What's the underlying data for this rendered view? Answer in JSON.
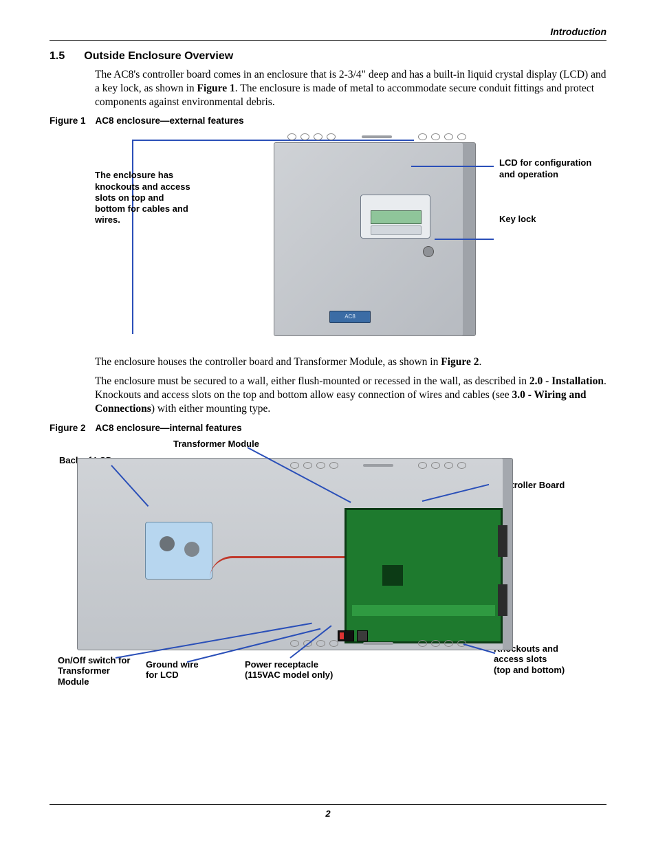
{
  "running_head": "Introduction",
  "section": {
    "num": "1.5",
    "title": "Outside Enclosure Overview"
  },
  "p1": {
    "a": "The AC8's controller board comes in an enclosure that is 2-3/4\" deep and has a built-in liquid crystal display (LCD) and a key lock, as shown in ",
    "b": "Figure 1",
    "c": ". The enclosure is made of metal to accommodate secure conduit fittings and protect components against environmental debris."
  },
  "fig1": {
    "label_a": "Figure 1",
    "label_b": "AC8 enclosure—external features",
    "ann_left": "The enclosure has knockouts and access slots on top and bottom for cables and wires.",
    "ann_lcd": "LCD for configuration and operation",
    "ann_lock": "Key lock",
    "enc_badge": "AC8"
  },
  "p2": {
    "a": "The enclosure houses the controller board and Transformer Module, as shown in ",
    "b": "Figure 2",
    "c": "."
  },
  "p3": {
    "a": "The enclosure must be secured to a wall, either flush-mounted or recessed in the wall, as described in ",
    "b": "2.0 - Installation",
    "c": ". Knockouts and access slots on the top and bottom allow easy connection of wires and cables (see ",
    "d": "3.0 - Wiring and Connections",
    "e": ") with either mounting type."
  },
  "fig2": {
    "label_a": "Figure 2",
    "label_b": "AC8 enclosure—internal features",
    "ann_transformer": "Transformer Module",
    "ann_backlcd": "Back of LCD",
    "ann_controller": "Controller Board",
    "ann_onoff": "On/Off switch for Transformer Module",
    "ann_gnd": "Ground wire for LCD",
    "ann_recept1": "Power receptacle",
    "ann_recept2": "(115VAC model only)",
    "ann_knock1": "Knockouts and access slots",
    "ann_knock2": "(top and bottom)"
  },
  "page_number": "2"
}
